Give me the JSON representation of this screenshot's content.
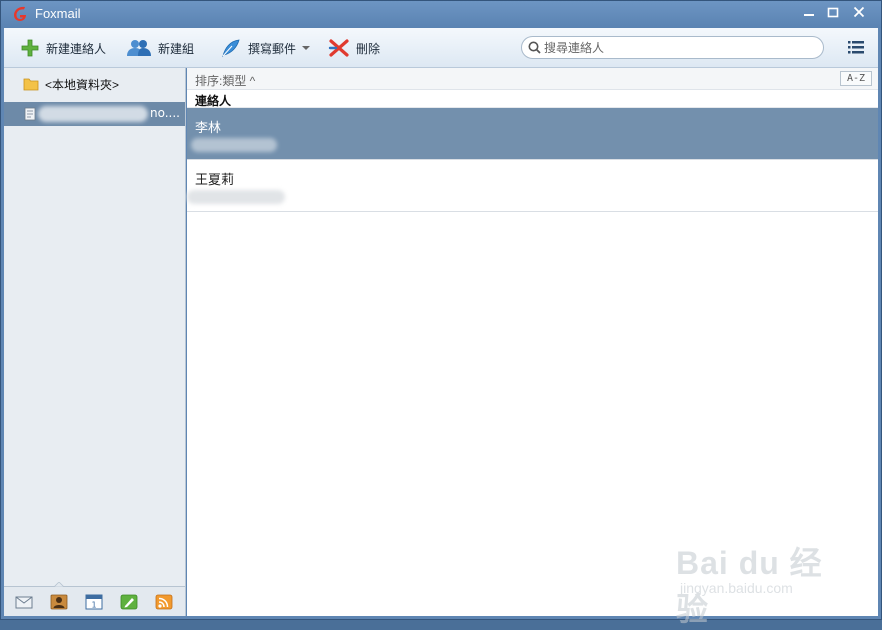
{
  "app": {
    "title": "Foxmail"
  },
  "toolbar": {
    "new_contact": "新建連絡人",
    "new_group": "新建組",
    "compose": "撰寫郵件",
    "delete": "刪除",
    "search_placeholder": "搜尋連絡人"
  },
  "sidebar": {
    "folder_label": "<本地資料夾>",
    "account_tail": "no...."
  },
  "main": {
    "sort_label": "排序:類型 ^",
    "az_label": "A-Z",
    "column_header": "連絡人",
    "contacts": [
      {
        "name": "李林"
      },
      {
        "name": "王夏莉"
      }
    ]
  },
  "watermark": {
    "brand": "Bai du 经验",
    "url": "jingyan.baidu.com"
  },
  "colors": {
    "accent": "#5f86b3",
    "selected_row": "#7390ad"
  }
}
